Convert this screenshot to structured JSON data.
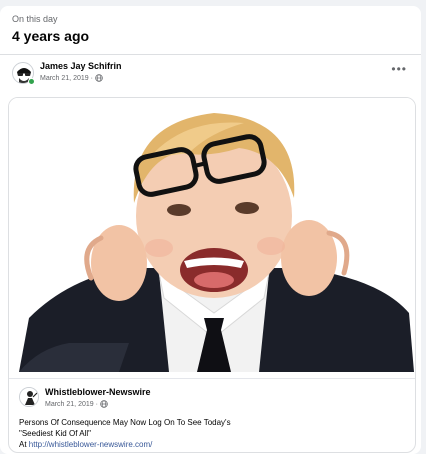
{
  "memory": {
    "eyebrow": "On this day",
    "headline": "4 years ago"
  },
  "post": {
    "author": "James Jay Schifrin",
    "date": "March 21, 2019",
    "separator": "·",
    "privacy_icon": "globe-icon",
    "more_icon": "more-horizontal-icon",
    "more_label": "•••",
    "online": true
  },
  "shared": {
    "photo_description_icon": "child-photo",
    "page_name": "Whistleblower-Newswire",
    "date": "March 21, 2019",
    "separator": "·",
    "line1": "Persons Of Consequence May Now Log On To See Today's",
    "line2": "\"Seediest Kid Of All\"",
    "line3_prefix": "At ",
    "link": "http://whistleblower-newswire.com/"
  },
  "colors": {
    "background": "#f0f2f5",
    "card": "#ffffff",
    "text": "#050505",
    "secondary": "#65676b",
    "link": "#385898",
    "online": "#31a24c"
  }
}
